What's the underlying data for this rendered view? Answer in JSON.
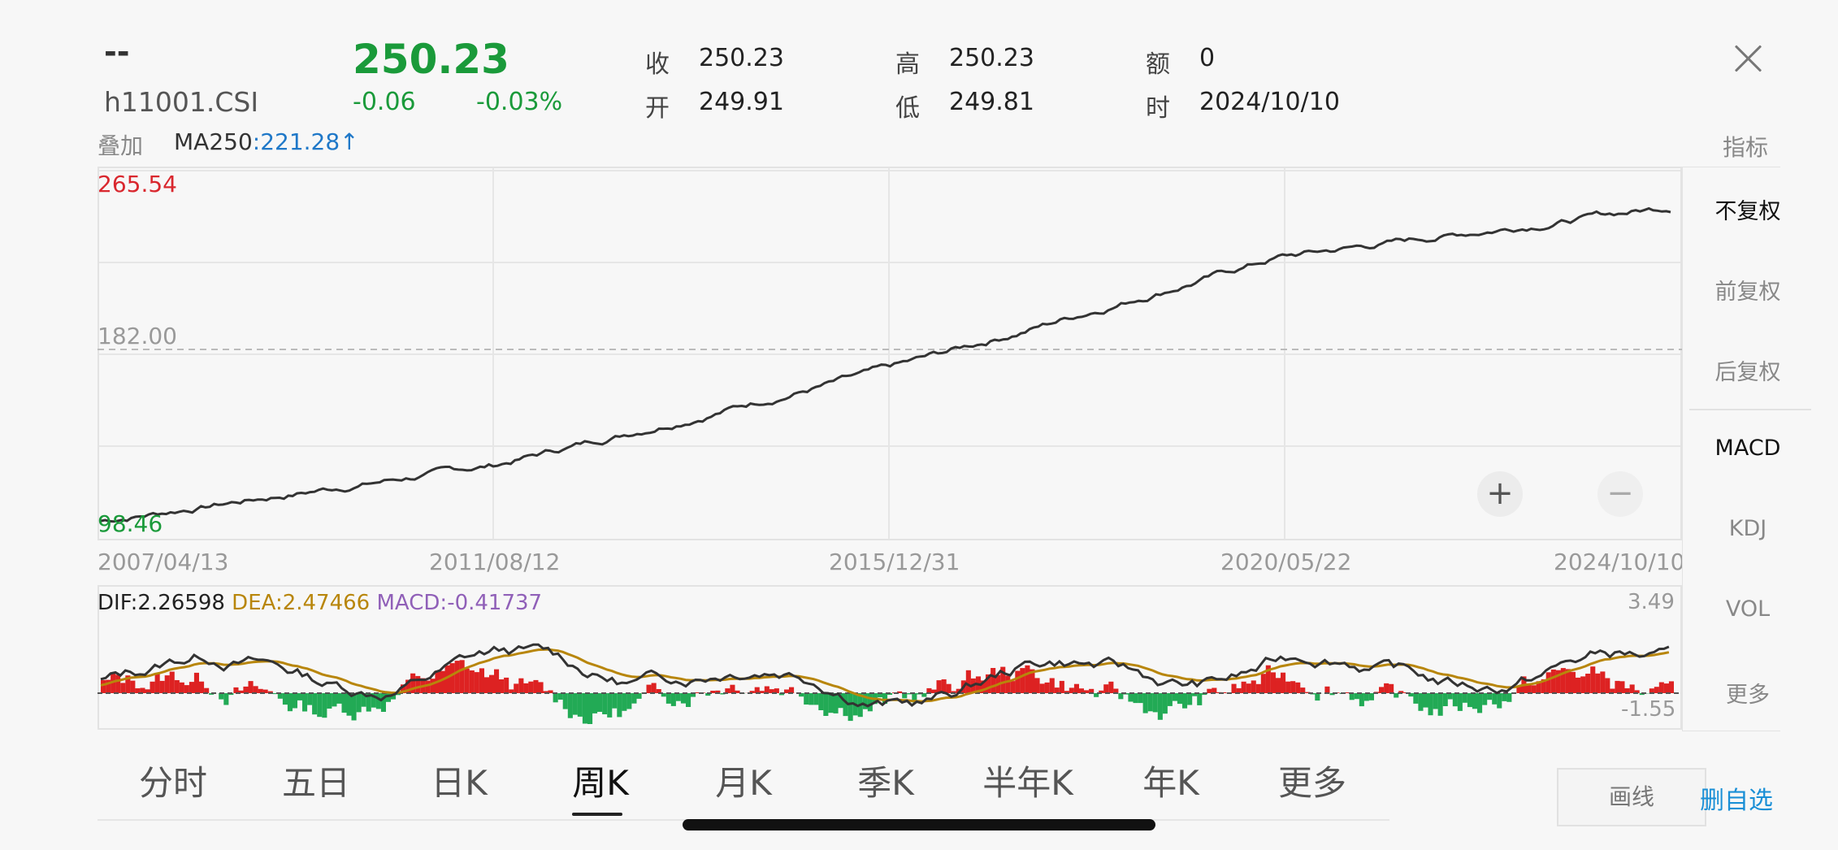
{
  "header": {
    "name": "--",
    "code": "h11001.CSI",
    "price": "250.23",
    "change": "-0.06",
    "change_pct": "-0.03%",
    "close_label": "收",
    "close_value": "250.23",
    "open_label": "开",
    "open_value": "249.91",
    "high_label": "高",
    "high_value": "250.23",
    "low_label": "低",
    "low_value": "249.81",
    "amount_label": "额",
    "amount_value": "0",
    "time_label": "时",
    "time_value": "2024/10/10"
  },
  "overlay": {
    "label": "叠加",
    "ma_name": "MA250",
    "ma_value": ":221.28",
    "ma_arrow": "↑",
    "indicator_label": "指标"
  },
  "main_chart": {
    "y_max_label": "265.54",
    "y_mid_label": "182.00",
    "y_min_label": "98.46",
    "x_labels": [
      "2007/04/13",
      "2011/08/12",
      "2015/12/31",
      "2020/05/22",
      "2024/10/10"
    ]
  },
  "macd": {
    "dif": "DIF:2.26598",
    "dea": "DEA:2.47466",
    "macd": "MACD:-0.41737",
    "y_max_label": "3.49",
    "y_min_label": "-1.55"
  },
  "chart_data": {
    "type": "line",
    "x": [
      "2007/04/13",
      "2011/08/12",
      "2015/12/31",
      "2020/05/22",
      "2024/10/10"
    ],
    "series": [
      {
        "values": [
          100.0,
          126.5,
          172.0,
          226.0,
          250.23
        ]
      }
    ],
    "ylim": [
      98.46,
      265.54
    ],
    "reference_line": 182.0,
    "grid": true,
    "colors": {
      "price_line": "#333333",
      "dif": "#333333",
      "dea": "#b8860b",
      "macd_pos": "#dd2222",
      "macd_neg": "#22aa55"
    }
  },
  "side_menu": {
    "items": [
      "不复权",
      "前复权",
      "后复权",
      "MACD",
      "KDJ",
      "VOL",
      "更多"
    ]
  },
  "zoom": {
    "plus": "+",
    "minus": "−"
  },
  "tabs": [
    "分时",
    "五日",
    "日K",
    "周K",
    "月K",
    "季K",
    "半年K",
    "年K",
    "更多"
  ],
  "actions": {
    "draw": "画线",
    "remove_watch": "删自选"
  },
  "colors": {
    "up": "#ff2d2d",
    "down": "#1a9a3a",
    "blue": "#1f78c8",
    "max_label": "#d9272e",
    "min_label": "#1a9a3a",
    "dea": "#b8860b",
    "macd_text": "#9060b8",
    "remove": "#1a8fd6"
  }
}
